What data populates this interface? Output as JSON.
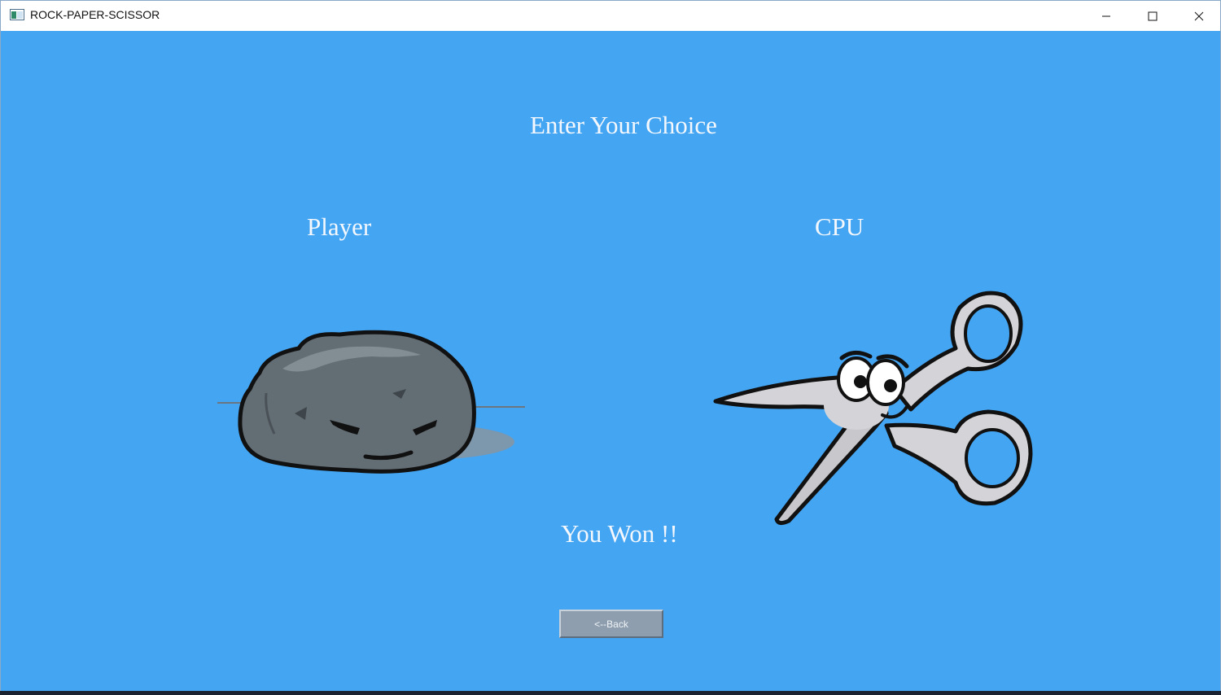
{
  "window": {
    "title": "ROCK-PAPER-SCISSOR",
    "icons": {
      "app": "app-window-icon",
      "minimize": "minimize-icon",
      "maximize": "maximize-icon",
      "close": "close-icon"
    }
  },
  "game": {
    "heading": "Enter Your Choice",
    "player_label": "Player",
    "cpu_label": "CPU",
    "player_choice": "rock",
    "cpu_choice": "scissors",
    "result": "You Won !!",
    "back_label": "<--Back"
  },
  "colors": {
    "background": "#44a5f3",
    "text": "#f4f8fc",
    "button": "#8e9eae"
  }
}
